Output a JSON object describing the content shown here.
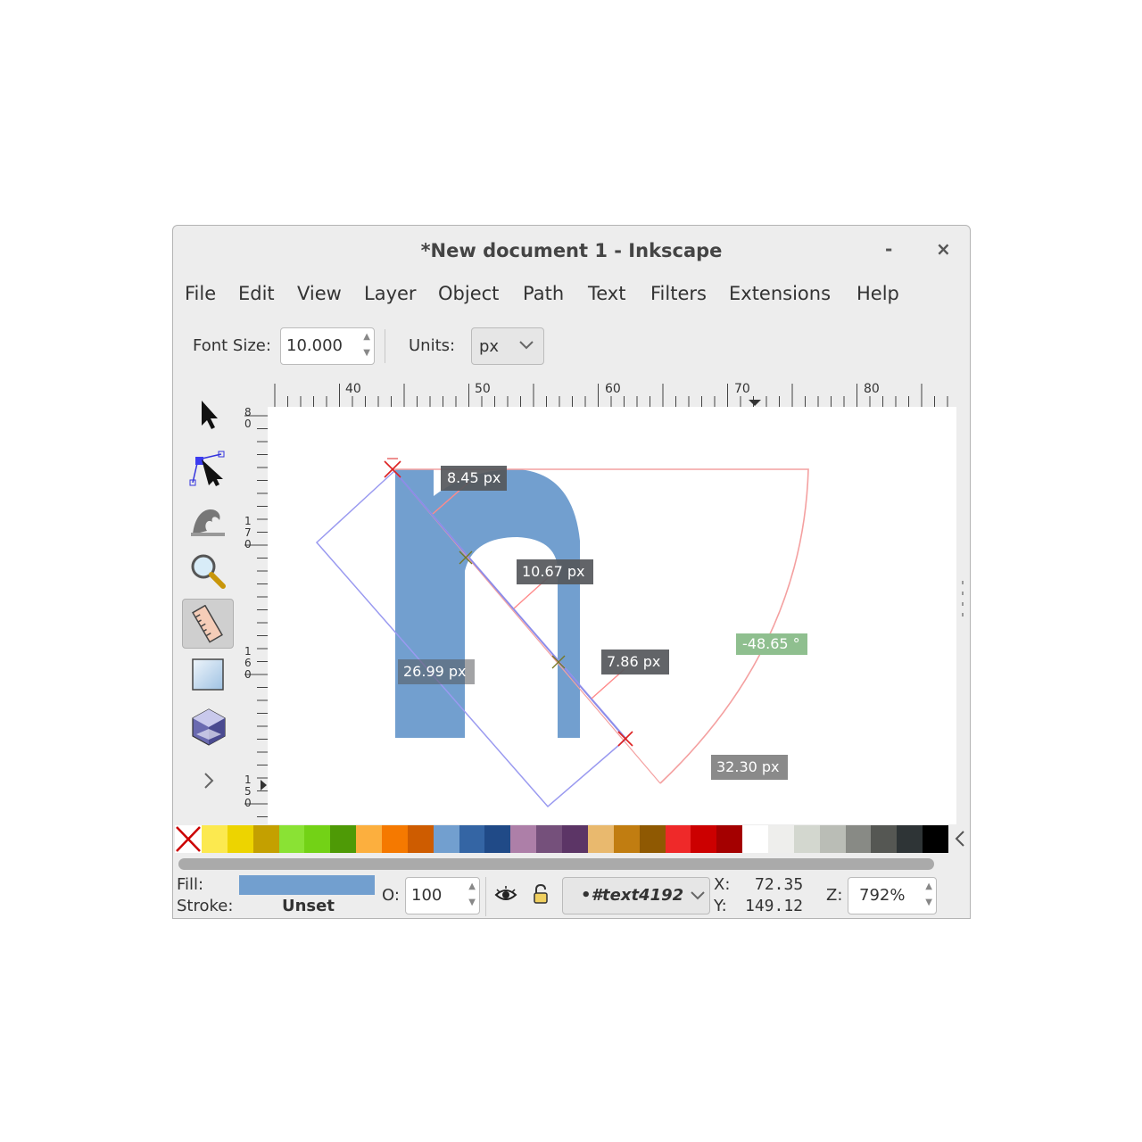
{
  "window": {
    "title": "*New document 1 - Inkscape",
    "minimize": "-",
    "close": "×"
  },
  "menu": [
    "File",
    "Edit",
    "View",
    "Layer",
    "Object",
    "Path",
    "Text",
    "Filters",
    "Extensions",
    "Help"
  ],
  "toolbar": {
    "font_size_label": "Font Size:",
    "font_size_value": "10.000",
    "units_label": "Units:",
    "units_value": "px"
  },
  "tools": [
    "selector-tool",
    "node-tool",
    "tweak-tool",
    "zoom-tool",
    "measure-tool",
    "rectangle-tool",
    "3d-box-tool",
    "more-tools"
  ],
  "rulers": {
    "horizontal_labels": [
      "40",
      "50",
      "60",
      "70",
      "80"
    ],
    "vertical_labels": [
      [
        "1",
        "8",
        "0"
      ],
      [
        "1",
        "7",
        "0"
      ],
      [
        "1",
        "6",
        "0"
      ],
      [
        "1",
        "5",
        "0"
      ]
    ]
  },
  "measurements": {
    "seg1": "8.45 px",
    "seg2": "10.67 px",
    "seg3": "7.86 px",
    "total": "26.99 px",
    "angle": "-48.65 °",
    "length": "32.30 px"
  },
  "glyph": {
    "char": "n",
    "color": "#729fcf"
  },
  "palette": [
    "#fce94f",
    "#edd400",
    "#c4a000",
    "#8ae234",
    "#73d216",
    "#4e9a06",
    "#fcaf3e",
    "#f57900",
    "#ce5c00",
    "#729fcf",
    "#3465a4",
    "#204a87",
    "#ad7fa8",
    "#75507b",
    "#5c3566",
    "#e9b96e",
    "#c17d11",
    "#8f5902",
    "#ef2929",
    "#cc0000",
    "#a40000",
    "#ffffff",
    "#eeeeec",
    "#d3d7cf",
    "#babdb6",
    "#888a85",
    "#555753",
    "#2e3436",
    "#000000"
  ],
  "status": {
    "fill_label": "Fill:",
    "stroke_label": "Stroke:",
    "stroke_value": "Unset",
    "fill_color": "#729fcf",
    "opacity_label": "O:",
    "opacity_value": "100",
    "object_id": "•#text4192",
    "x_label": "X:",
    "x_value": "72.35",
    "y_label": "Y:",
    "y_value": "149.12",
    "zoom_label": "Z:",
    "zoom_value": "792%"
  }
}
